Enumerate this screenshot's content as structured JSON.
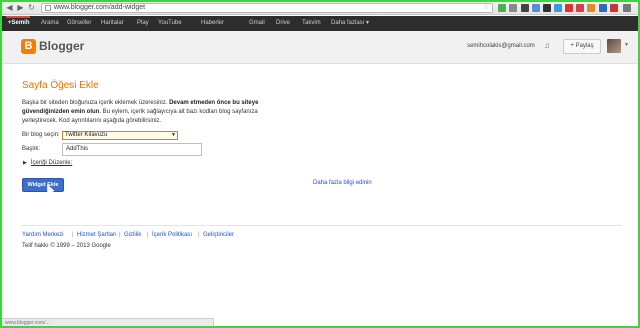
{
  "browser": {
    "url": "www.blogger.com/add-widget"
  },
  "google_bar": {
    "items": [
      "+Semih",
      "Arama",
      "Görseller",
      "Haritalar",
      "Play",
      "YouTube",
      "Haberler",
      "Gmail",
      "Drive",
      "Takvim",
      "Daha fazlası ▾"
    ]
  },
  "header": {
    "logo_letter": "B",
    "logo_text": "Blogger",
    "email": "semihcolakis@gmail.com",
    "share_label": "+ Paylaş"
  },
  "main": {
    "title": "Sayfa Öğesi Ekle",
    "desc_1": "Başka bir siteden bloğunuza içerik eklemek üzeresiniz. ",
    "desc_bold_1": "Devam etmeden önce bu siteye güvendiğinizden emin olun",
    "desc_2": ". Bu eylem, içerik sağlayıcıya ait bazı kodları blog sayfanıza yerleştirecek. Kod ayrıntılarını aşağıda görebilirsiniz.",
    "blog_label": "Bir blog seçin:",
    "blog_value": "Twitter Kılavuzu",
    "title_label": "Başlık:",
    "title_value": "AddThis",
    "expander": "İçeriği Düzenle:",
    "add_button": "Widget Ekle",
    "more_info": "Daha fazla bilgi edinin"
  },
  "footer": {
    "links": [
      "Yardım Merkezi",
      "Hizmet Şartları",
      "Gizlilik",
      "İçerik Politikası",
      "Geliştiriciler"
    ],
    "copyright": "Telif hakkı © 1999 – 2013 Google"
  },
  "status_bar": "www.blogger.com/..."
}
